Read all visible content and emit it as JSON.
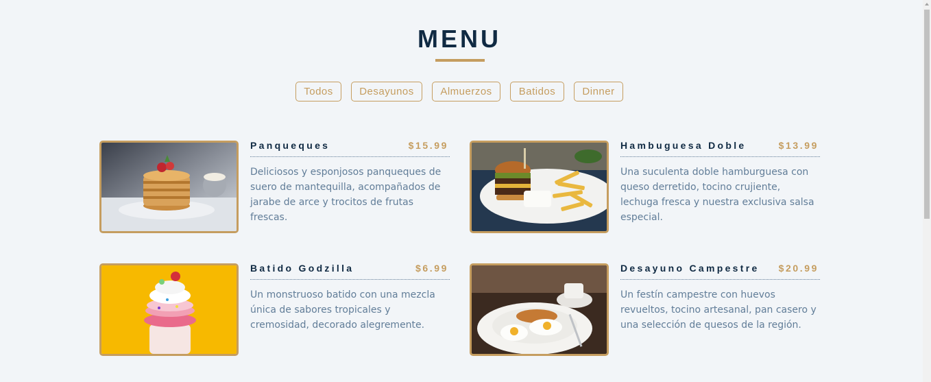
{
  "header": {
    "title": "MENU"
  },
  "filters": [
    {
      "label": "Todos"
    },
    {
      "label": "Desayunos"
    },
    {
      "label": "Almuerzos"
    },
    {
      "label": "Batidos"
    },
    {
      "label": "Dinner"
    }
  ],
  "menu": {
    "items": [
      {
        "name": "Panqueques",
        "price": "$15.99",
        "description": "Deliciosos y esponjosos panqueques de suero de mantequilla, acompañados de jarabe de arce y trocitos de frutas frescas."
      },
      {
        "name": "Hambuguesa Doble",
        "price": "$13.99",
        "description": "Una suculenta doble hamburguesa con queso derretido, tocino crujiente, lechuga fresca y nuestra exclusiva salsa especial."
      },
      {
        "name": "Batido Godzilla",
        "price": "$6.99",
        "description": "Un monstruoso batido con una mezcla única de sabores tropicales y cremosidad, decorado alegremente."
      },
      {
        "name": "Desayuno Campestre",
        "price": "$20.99",
        "description": "Un festín campestre con huevos revueltos, tocino artesanal, pan casero y una selección de quesos de la región."
      }
    ]
  },
  "colors": {
    "background": "#f2f5f8",
    "accent": "#c59d5f",
    "title": "#102a43",
    "text": "#617d98"
  }
}
